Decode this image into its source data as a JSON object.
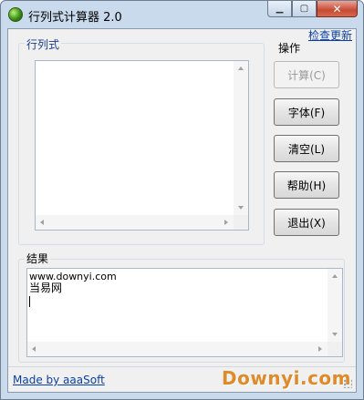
{
  "window": {
    "title": "行列式计算器 2.0",
    "close_symbol": "✕",
    "min_symbol": "▁",
    "max_symbol": "▢"
  },
  "toolbar": {
    "check_update": "检查更新"
  },
  "determinant": {
    "label": "行列式",
    "value": ""
  },
  "operations": {
    "label": "操作",
    "buttons": [
      {
        "label": "计算(C)",
        "enabled": false
      },
      {
        "label": "字体(F)",
        "enabled": true
      },
      {
        "label": "清空(L)",
        "enabled": true
      },
      {
        "label": "帮助(H)",
        "enabled": true
      },
      {
        "label": "退出(X)",
        "enabled": true
      }
    ]
  },
  "result": {
    "label": "结果",
    "lines": [
      "www.downyi.com",
      "当易网"
    ]
  },
  "footer": {
    "made_by": "Made by aaaSoft",
    "watermark": "Downyi.com"
  }
}
